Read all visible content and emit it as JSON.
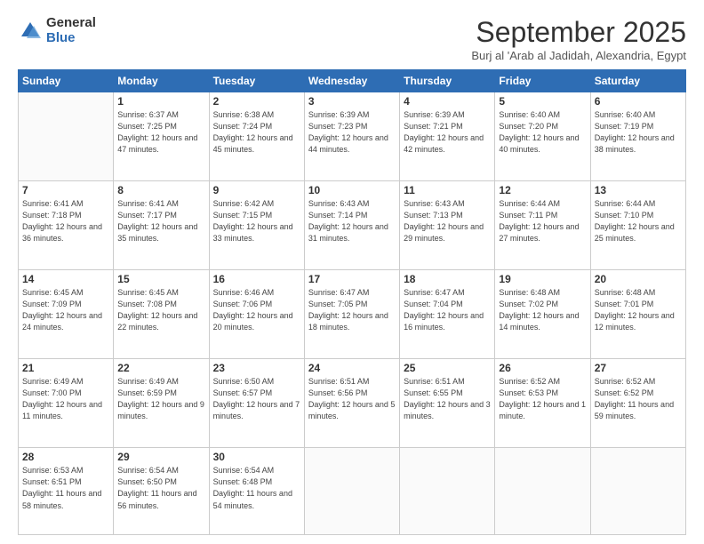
{
  "logo": {
    "general": "General",
    "blue": "Blue"
  },
  "header": {
    "month": "September 2025",
    "location": "Burj al 'Arab al Jadidah, Alexandria, Egypt"
  },
  "weekdays": [
    "Sunday",
    "Monday",
    "Tuesday",
    "Wednesday",
    "Thursday",
    "Friday",
    "Saturday"
  ],
  "weeks": [
    [
      {
        "day": "",
        "sunrise": "",
        "sunset": "",
        "daylight": ""
      },
      {
        "day": "1",
        "sunrise": "Sunrise: 6:37 AM",
        "sunset": "Sunset: 7:25 PM",
        "daylight": "Daylight: 12 hours and 47 minutes."
      },
      {
        "day": "2",
        "sunrise": "Sunrise: 6:38 AM",
        "sunset": "Sunset: 7:24 PM",
        "daylight": "Daylight: 12 hours and 45 minutes."
      },
      {
        "day": "3",
        "sunrise": "Sunrise: 6:39 AM",
        "sunset": "Sunset: 7:23 PM",
        "daylight": "Daylight: 12 hours and 44 minutes."
      },
      {
        "day": "4",
        "sunrise": "Sunrise: 6:39 AM",
        "sunset": "Sunset: 7:21 PM",
        "daylight": "Daylight: 12 hours and 42 minutes."
      },
      {
        "day": "5",
        "sunrise": "Sunrise: 6:40 AM",
        "sunset": "Sunset: 7:20 PM",
        "daylight": "Daylight: 12 hours and 40 minutes."
      },
      {
        "day": "6",
        "sunrise": "Sunrise: 6:40 AM",
        "sunset": "Sunset: 7:19 PM",
        "daylight": "Daylight: 12 hours and 38 minutes."
      }
    ],
    [
      {
        "day": "7",
        "sunrise": "Sunrise: 6:41 AM",
        "sunset": "Sunset: 7:18 PM",
        "daylight": "Daylight: 12 hours and 36 minutes."
      },
      {
        "day": "8",
        "sunrise": "Sunrise: 6:41 AM",
        "sunset": "Sunset: 7:17 PM",
        "daylight": "Daylight: 12 hours and 35 minutes."
      },
      {
        "day": "9",
        "sunrise": "Sunrise: 6:42 AM",
        "sunset": "Sunset: 7:15 PM",
        "daylight": "Daylight: 12 hours and 33 minutes."
      },
      {
        "day": "10",
        "sunrise": "Sunrise: 6:43 AM",
        "sunset": "Sunset: 7:14 PM",
        "daylight": "Daylight: 12 hours and 31 minutes."
      },
      {
        "day": "11",
        "sunrise": "Sunrise: 6:43 AM",
        "sunset": "Sunset: 7:13 PM",
        "daylight": "Daylight: 12 hours and 29 minutes."
      },
      {
        "day": "12",
        "sunrise": "Sunrise: 6:44 AM",
        "sunset": "Sunset: 7:11 PM",
        "daylight": "Daylight: 12 hours and 27 minutes."
      },
      {
        "day": "13",
        "sunrise": "Sunrise: 6:44 AM",
        "sunset": "Sunset: 7:10 PM",
        "daylight": "Daylight: 12 hours and 25 minutes."
      }
    ],
    [
      {
        "day": "14",
        "sunrise": "Sunrise: 6:45 AM",
        "sunset": "Sunset: 7:09 PM",
        "daylight": "Daylight: 12 hours and 24 minutes."
      },
      {
        "day": "15",
        "sunrise": "Sunrise: 6:45 AM",
        "sunset": "Sunset: 7:08 PM",
        "daylight": "Daylight: 12 hours and 22 minutes."
      },
      {
        "day": "16",
        "sunrise": "Sunrise: 6:46 AM",
        "sunset": "Sunset: 7:06 PM",
        "daylight": "Daylight: 12 hours and 20 minutes."
      },
      {
        "day": "17",
        "sunrise": "Sunrise: 6:47 AM",
        "sunset": "Sunset: 7:05 PM",
        "daylight": "Daylight: 12 hours and 18 minutes."
      },
      {
        "day": "18",
        "sunrise": "Sunrise: 6:47 AM",
        "sunset": "Sunset: 7:04 PM",
        "daylight": "Daylight: 12 hours and 16 minutes."
      },
      {
        "day": "19",
        "sunrise": "Sunrise: 6:48 AM",
        "sunset": "Sunset: 7:02 PM",
        "daylight": "Daylight: 12 hours and 14 minutes."
      },
      {
        "day": "20",
        "sunrise": "Sunrise: 6:48 AM",
        "sunset": "Sunset: 7:01 PM",
        "daylight": "Daylight: 12 hours and 12 minutes."
      }
    ],
    [
      {
        "day": "21",
        "sunrise": "Sunrise: 6:49 AM",
        "sunset": "Sunset: 7:00 PM",
        "daylight": "Daylight: 12 hours and 11 minutes."
      },
      {
        "day": "22",
        "sunrise": "Sunrise: 6:49 AM",
        "sunset": "Sunset: 6:59 PM",
        "daylight": "Daylight: 12 hours and 9 minutes."
      },
      {
        "day": "23",
        "sunrise": "Sunrise: 6:50 AM",
        "sunset": "Sunset: 6:57 PM",
        "daylight": "Daylight: 12 hours and 7 minutes."
      },
      {
        "day": "24",
        "sunrise": "Sunrise: 6:51 AM",
        "sunset": "Sunset: 6:56 PM",
        "daylight": "Daylight: 12 hours and 5 minutes."
      },
      {
        "day": "25",
        "sunrise": "Sunrise: 6:51 AM",
        "sunset": "Sunset: 6:55 PM",
        "daylight": "Daylight: 12 hours and 3 minutes."
      },
      {
        "day": "26",
        "sunrise": "Sunrise: 6:52 AM",
        "sunset": "Sunset: 6:53 PM",
        "daylight": "Daylight: 12 hours and 1 minute."
      },
      {
        "day": "27",
        "sunrise": "Sunrise: 6:52 AM",
        "sunset": "Sunset: 6:52 PM",
        "daylight": "Daylight: 11 hours and 59 minutes."
      }
    ],
    [
      {
        "day": "28",
        "sunrise": "Sunrise: 6:53 AM",
        "sunset": "Sunset: 6:51 PM",
        "daylight": "Daylight: 11 hours and 58 minutes."
      },
      {
        "day": "29",
        "sunrise": "Sunrise: 6:54 AM",
        "sunset": "Sunset: 6:50 PM",
        "daylight": "Daylight: 11 hours and 56 minutes."
      },
      {
        "day": "30",
        "sunrise": "Sunrise: 6:54 AM",
        "sunset": "Sunset: 6:48 PM",
        "daylight": "Daylight: 11 hours and 54 minutes."
      },
      {
        "day": "",
        "sunrise": "",
        "sunset": "",
        "daylight": ""
      },
      {
        "day": "",
        "sunrise": "",
        "sunset": "",
        "daylight": ""
      },
      {
        "day": "",
        "sunrise": "",
        "sunset": "",
        "daylight": ""
      },
      {
        "day": "",
        "sunrise": "",
        "sunset": "",
        "daylight": ""
      }
    ]
  ]
}
